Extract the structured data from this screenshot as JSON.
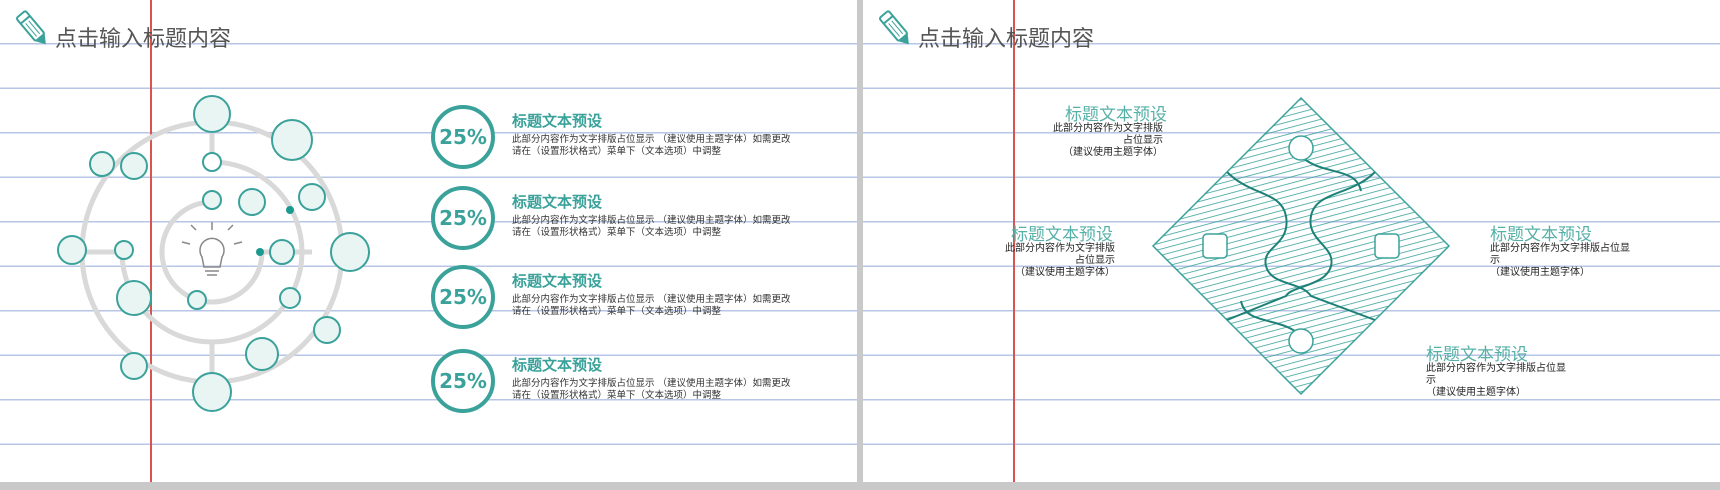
{
  "slides": [
    {
      "title": "点击输入标题内容",
      "items": [
        {
          "percent": "25%",
          "title": "标题文本预设",
          "body": "此部分内容作为文字排版占位显示 （建议使用主题字体）如需更改请在（设置形状格式）菜单下（文本选项）中调整"
        },
        {
          "percent": "25%",
          "title": "标题文本预设",
          "body": "此部分内容作为文字排版占位显示 （建议使用主题字体）如需更改请在（设置形状格式）菜单下（文本选项）中调整"
        },
        {
          "percent": "25%",
          "title": "标题文本预设",
          "body": "此部分内容作为文字排版占位显示 （建议使用主题字体）如需更改请在（设置形状格式）菜单下（文本选项）中调整"
        },
        {
          "percent": "25%",
          "title": "标题文本预设",
          "body": "此部分内容作为文字排版占位显示 （建议使用主题字体）如需更改请在（设置形状格式）菜单下（文本选项）中调整"
        }
      ]
    },
    {
      "title": "点击输入标题内容",
      "items": [
        {
          "title": "标题文本预设",
          "body": "此部分内容作为文字排版\n占位显示\n（建议使用主题字体）"
        },
        {
          "title": "标题文本预设",
          "body": "此部分内容作为文字排版\n占位显示\n（建议使用主题字体）"
        },
        {
          "title": "标题文本预设",
          "body": "此部分内容作为文字排版占位显\n示\n（建议使用主题字体）"
        },
        {
          "title": "标题文本预设",
          "body": "此部分内容作为文字排版占位显\n示\n（建议使用主题字体）"
        }
      ]
    }
  ],
  "colors": {
    "accent": "#3aa29a",
    "rule": "#b7c5e6",
    "margin": "#d9534f"
  },
  "icons": [
    "pencil-icon",
    "lightbulb-icon",
    "puzzle-icon",
    "target-icon",
    "clock-icon",
    "building-icon",
    "gear-icon",
    "dollar-icon",
    "people-icon",
    "refresh-icon",
    "globe-icon",
    "graduation-cap-icon"
  ]
}
